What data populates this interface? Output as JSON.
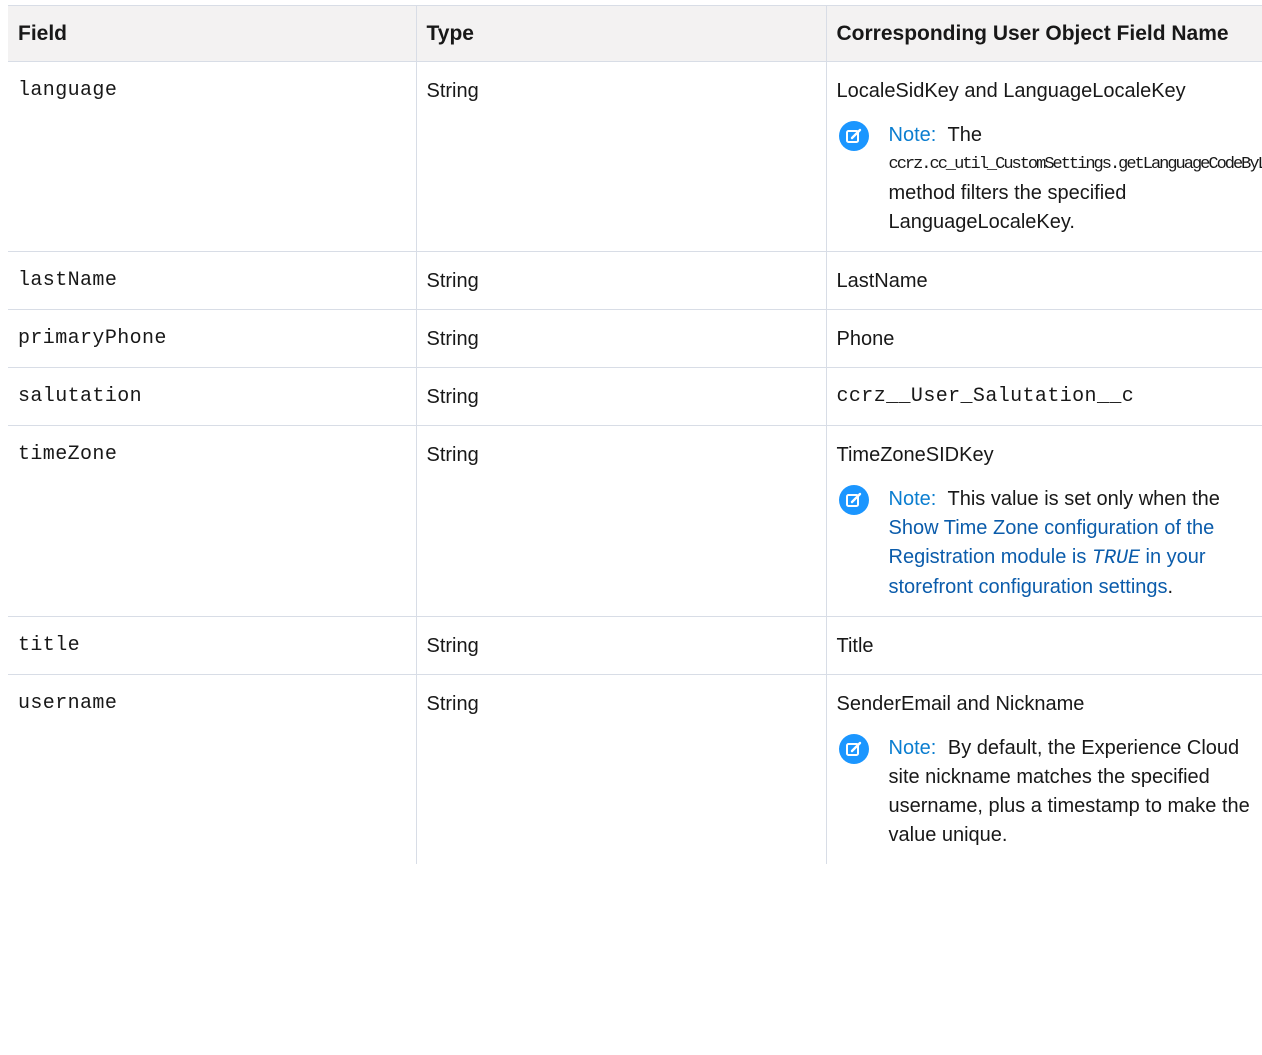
{
  "headers": {
    "field": "Field",
    "type": "Type",
    "user_field": "Corresponding User Object Field Name"
  },
  "rows": [
    {
      "field": "language",
      "type": "String",
      "user_field": "LocaleSidKey and LanguageLocaleKey",
      "note": {
        "label": "Note:",
        "text_before": "The",
        "code": "ccrz.cc_util_CustomSettings.getLanguageCodeByLocale",
        "text_after": "method filters the specified LanguageLocaleKey."
      }
    },
    {
      "field": "lastName",
      "type": "String",
      "user_field": "LastName"
    },
    {
      "field": "primaryPhone",
      "type": "String",
      "user_field": "Phone"
    },
    {
      "field": "salutation",
      "type": "String",
      "user_field": "ccrz__User_Salutation__c"
    },
    {
      "field": "timeZone",
      "type": "String",
      "user_field": "TimeZoneSIDKey",
      "note": {
        "label": "Note:",
        "text_before": "This value is set only when the",
        "link1": "Show Time Zone configuration of the Registration module is",
        "link_code": "TRUE",
        "link2": "in your storefront configuration settings",
        "text_after": "."
      }
    },
    {
      "field": "title",
      "type": "String",
      "user_field": "Title"
    },
    {
      "field": "username",
      "type": "String",
      "user_field": "SenderEmail and Nickname",
      "note": {
        "label": "Note:",
        "text_before": "By default, the Experience Cloud site nickname matches the specified username, plus a timestamp to make the value unique."
      }
    }
  ],
  "icon": "note-edit-icon",
  "colors": {
    "accent": "#1b96ff",
    "note_label": "#0b7ed0",
    "link": "#0b5cab",
    "header_bg": "#f3f2f2",
    "border": "#d8dde6"
  }
}
